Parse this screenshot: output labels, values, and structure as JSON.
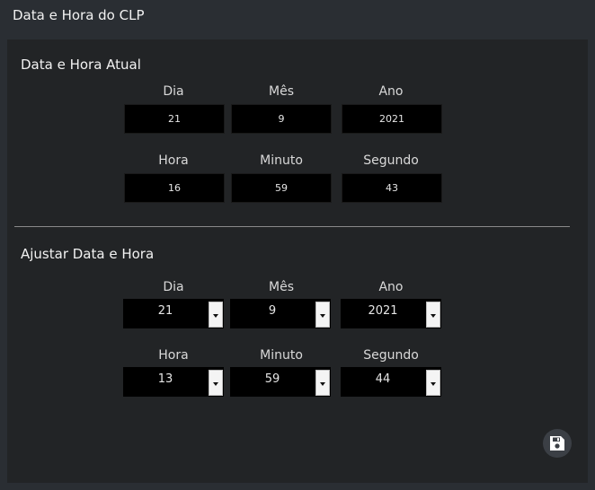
{
  "window": {
    "title": "Data e Hora do CLP"
  },
  "current": {
    "title": "Data e Hora Atual",
    "fields": [
      {
        "label": "Dia",
        "value": "21"
      },
      {
        "label": "Mês",
        "value": "9"
      },
      {
        "label": "Ano",
        "value": "2021"
      },
      {
        "label": "Hora",
        "value": "16"
      },
      {
        "label": "Minuto",
        "value": "59"
      },
      {
        "label": "Segundo",
        "value": "43"
      }
    ]
  },
  "adjust": {
    "title": "Ajustar Data e Hora",
    "fields": [
      {
        "label": "Dia",
        "value": "21"
      },
      {
        "label": "Mês",
        "value": "9"
      },
      {
        "label": "Ano",
        "value": "2021"
      },
      {
        "label": "Hora",
        "value": "13"
      },
      {
        "label": "Minuto",
        "value": "59"
      },
      {
        "label": "Segundo",
        "value": "44"
      }
    ]
  },
  "icons": {
    "save": "save-icon"
  }
}
